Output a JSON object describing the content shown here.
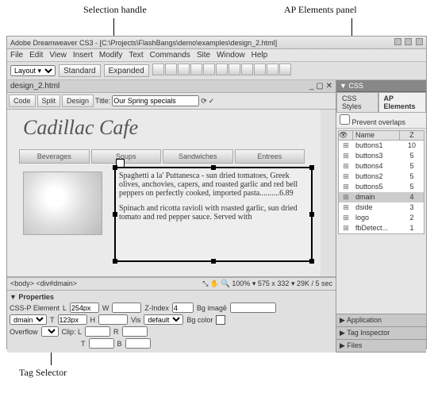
{
  "callouts": {
    "selection_handle": "Selection handle",
    "ap_elements_panel": "AP Elements panel",
    "tag_selector": "Tag Selector"
  },
  "titlebar": "Adobe Dreamweaver CS3 - [C:\\Projects\\FlashBangs\\demo\\examples\\design_2.html]",
  "menu": [
    "File",
    "Edit",
    "View",
    "Insert",
    "Modify",
    "Text",
    "Commands",
    "Site",
    "Window",
    "Help"
  ],
  "insertbar": {
    "layout_label": "Layout ▾",
    "tabs": [
      "Standard",
      "Expanded"
    ]
  },
  "doc": {
    "tab": "design_2.html",
    "views": {
      "code": "Code",
      "split": "Split",
      "design": "Design"
    },
    "title_label": "Title:",
    "title": "Our Spring specials"
  },
  "page": {
    "logo": "Cadillac Cafe",
    "nav": [
      "Beverages",
      "Soups",
      "Sandwiches",
      "Entrees"
    ],
    "para1": "Spaghetti a la' Puttanesca - sun dried tomatoes, Greek olives, anchovies, capers, and roasted garlic and red bell peppers on perfectly cooked, imported pasta..........6.89",
    "para2": "Spinach and ricotta ravioli with roasted garlic, sun dried tomato and red pepper sauce. Served with"
  },
  "status": {
    "tags": "<body> <div#dmain>",
    "zoom": "100%",
    "dim": "575 x 332",
    "size": "29K / 5 sec"
  },
  "props": {
    "header": "▼ Properties",
    "kind": "CSS-P Element",
    "id": "dmain",
    "L_label": "L",
    "L": "254px",
    "T_label": "T",
    "T": "123px",
    "W_label": "W",
    "H_label": "H",
    "Z_label": "Z-Index",
    "Z": "4",
    "vis_label": "Vis",
    "vis": "default",
    "bgimg_label": "Bg imagē",
    "bgcol_label": "Bg color",
    "overflow_label": "Overflow",
    "clip_label": "Clip: L",
    "clip_r": "R",
    "clip_t": "T",
    "clip_b": "B"
  },
  "css_panel": {
    "hdr": "▼ CSS",
    "tab_styles": "CSS Styles",
    "tab_ap": "AP Elements",
    "prevent": "Prevent overlaps",
    "col_name": "Name",
    "col_z": "Z",
    "rows": [
      {
        "icon": "⊞",
        "name": "buttons1",
        "z": "10"
      },
      {
        "icon": "⊞",
        "name": "buttons3",
        "z": "5"
      },
      {
        "icon": "⊞",
        "name": "buttons4",
        "z": "5"
      },
      {
        "icon": "⊞",
        "name": "buttons2",
        "z": "5"
      },
      {
        "icon": "⊞",
        "name": "buttons5",
        "z": "5"
      },
      {
        "icon": "⊞",
        "name": "dmain",
        "z": "4",
        "sel": true
      },
      {
        "icon": "⊞",
        "name": "dside",
        "z": "3"
      },
      {
        "icon": "⊞",
        "name": "logo",
        "z": "2"
      },
      {
        "icon": "⊞",
        "name": "fbDetect...",
        "z": "1"
      }
    ]
  },
  "side_bottom": [
    "▶ Application",
    "▶ Tag Inspector",
    "▶ Files"
  ]
}
